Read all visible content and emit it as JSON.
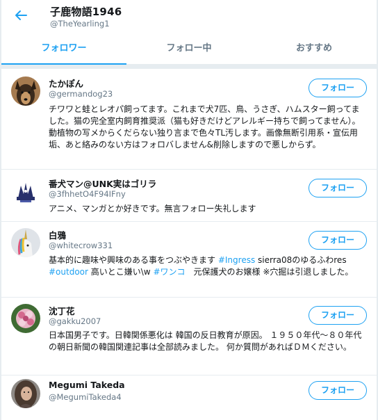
{
  "header": {
    "title": "子鹿物語1946",
    "handle": "@TheYearling1"
  },
  "tabs": [
    {
      "label": "フォロワー",
      "active": true
    },
    {
      "label": "フォロー中",
      "active": false
    },
    {
      "label": "おすすめ",
      "active": false
    }
  ],
  "accent_color": "#1da1f2",
  "users": [
    {
      "name": "たかぽん",
      "handle": "@germandog23",
      "avatar_icon": "dog-avatar",
      "follow_label": "フォロー",
      "bio": "チワワと蛙とレオパ飼ってます。これまで犬7匹、鳥、うさぎ、ハムスター飼ってました。猫の完全室内飼育推奨派（猫も好きだけどアレルギー持ちで飼ってません）。動植物の写メからくだらない独り言まで色々TL汚します。画像無断引用系・宣伝用垢、あと絡みのない方はフォロバしません&削除しますので悪しからず。"
    },
    {
      "name": "番犬マン@UNK実はゴリラ",
      "handle": "@3fhhetO4F94IFny",
      "avatar_icon": "anime-character-avatar",
      "follow_label": "フォロー",
      "bio": "アニメ、マンガとか好きです。無言フォロー失礼します"
    },
    {
      "name": "白鴉",
      "handle": "@whitecrow331",
      "avatar_icon": "unicorn-avatar",
      "follow_label": "フォロー",
      "bio_parts": [
        {
          "text": "基本的に趣味や興味のある事をつぶやきます ",
          "link": false
        },
        {
          "text": "#Ingress",
          "link": true
        },
        {
          "text": " sierra08のゆるふわres ",
          "link": false
        },
        {
          "text": "#outdoor",
          "link": true
        },
        {
          "text": " 高いとこ嫌い\\w ",
          "link": false
        },
        {
          "text": "#ワンコ",
          "link": true
        },
        {
          "text": "　元保護犬のお嬢様 ※穴掘は引退しました。",
          "link": false
        }
      ]
    },
    {
      "name": "沈丁花",
      "handle": "@gakku2007",
      "avatar_icon": "flower-avatar",
      "follow_label": "フォロー",
      "bio": "日本国男子です。日韓関係悪化は 韓国の反日教育が原因。 １９５０年代～８０年代の朝日新聞の韓国関連記事は全部読みました。 何か質問があればＤＭください。"
    },
    {
      "name": "Megumi Takeda",
      "handle": "@MegumiTakeda4",
      "avatar_icon": "woman-portrait-avatar",
      "follow_label": "フォロー"
    }
  ]
}
